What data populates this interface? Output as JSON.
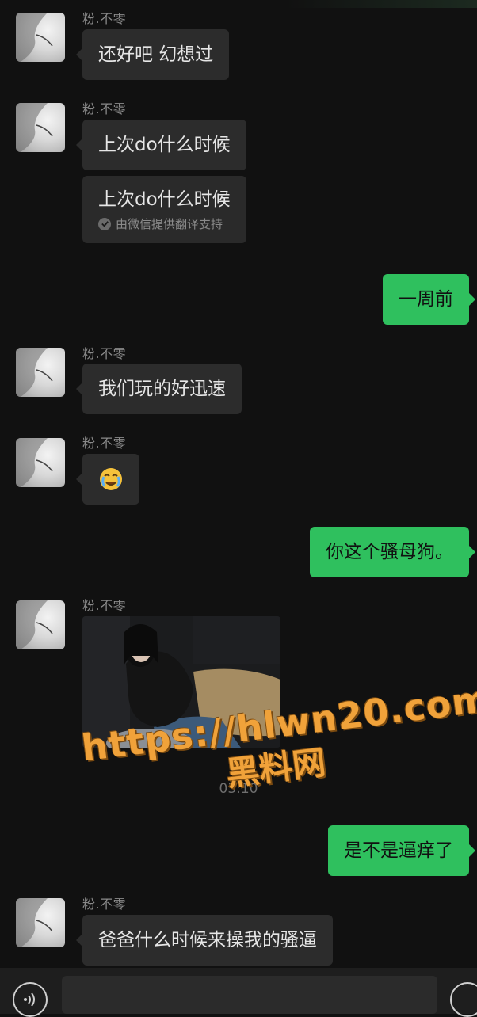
{
  "chat": {
    "sender_name": "粉.不零",
    "messages": [
      {
        "text": "还好吧 幻想过"
      },
      {
        "text": "上次do什么时候"
      },
      {
        "translation": "上次do什么时候",
        "note": "由微信提供翻译支持"
      },
      {
        "text": "一周前"
      },
      {
        "text": "我们玩的好迅速"
      },
      {
        "emoji": "😭"
      },
      {
        "text": "你这个骚母狗。"
      },
      {
        "text": "是不是逼痒了"
      },
      {
        "text": "爸爸什么时候来操我的骚逼"
      }
    ],
    "timestamp": "03:10"
  },
  "watermark": {
    "line1": "https://hlwn20.com",
    "line2": "黑料网"
  },
  "colors": {
    "background": "#111111",
    "incoming_bubble": "#2c2c2c",
    "outgoing_bubble": "#2fc05e",
    "watermark": "#f0a23a"
  },
  "icons": {
    "input_left": "voice-icon",
    "input_right": "emoji-icon"
  }
}
